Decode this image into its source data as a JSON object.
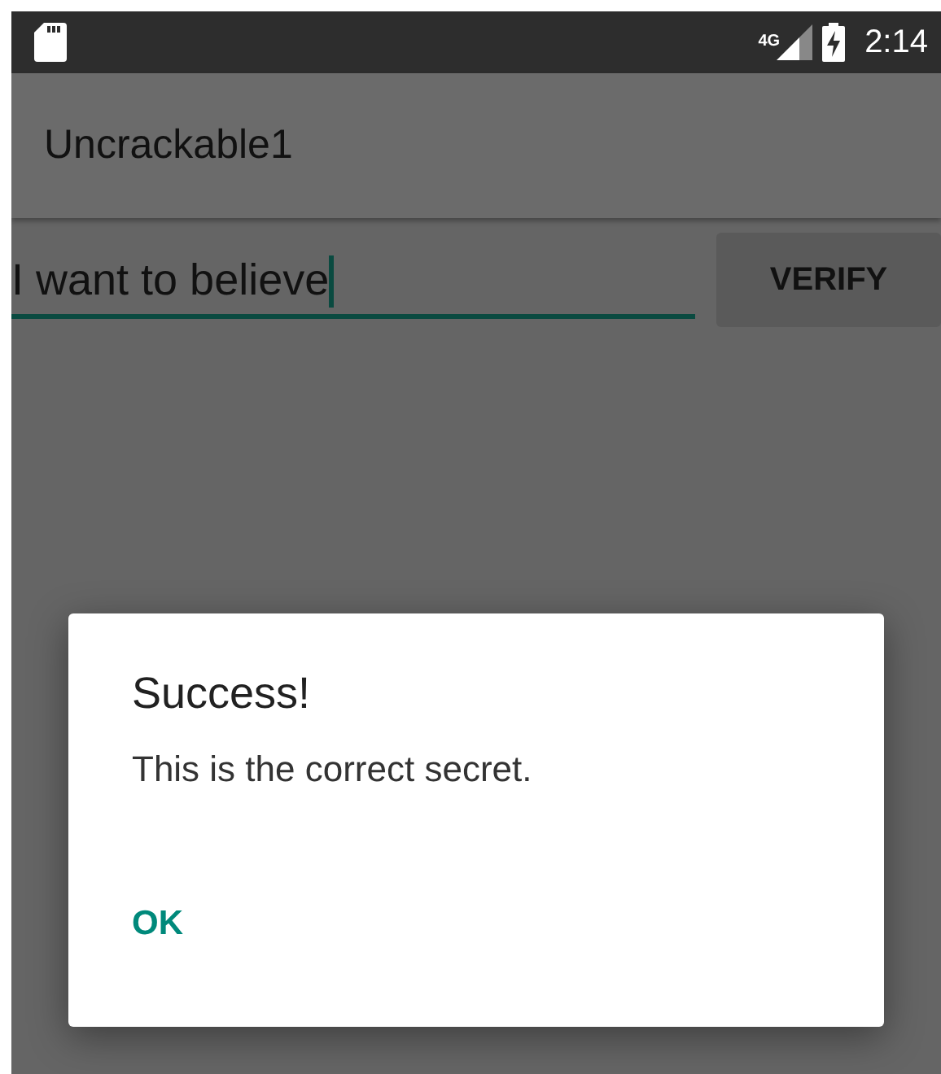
{
  "status_bar": {
    "network": "4G",
    "time": "2:14"
  },
  "app_bar": {
    "title": "Uncrackable1"
  },
  "secret_field": {
    "value": "I want to believe"
  },
  "verify_button": {
    "label": "VERIFY"
  },
  "dialog": {
    "title": "Success!",
    "message": "This is the correct secret.",
    "buttons": [
      "OK"
    ]
  }
}
